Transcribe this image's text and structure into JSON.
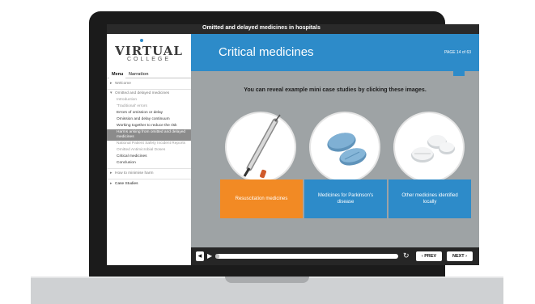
{
  "window": {
    "title": "Omitted and delayed medicines in hospitals"
  },
  "brand": {
    "name": "VIRTUAL",
    "subname": "COLLEGE"
  },
  "sidebar": {
    "tabs": [
      "Menu",
      "Narration"
    ],
    "items": [
      {
        "label": "Welcome",
        "type": "section"
      },
      {
        "label": "Omitted and delayed medicines",
        "type": "section-open"
      },
      {
        "label": "Introduction",
        "type": "dim"
      },
      {
        "label": "'Traditional' errors",
        "type": "dim"
      },
      {
        "label": "Errors of omission or delay",
        "type": "normal"
      },
      {
        "label": "Omission and delay continuum",
        "type": "normal"
      },
      {
        "label": "Working together to reduce the risk",
        "type": "normal"
      },
      {
        "label": "Harms arising from omitted and delayed medicines",
        "type": "highlight"
      },
      {
        "label": "National Patient Safety Incident Reports",
        "type": "dim"
      },
      {
        "label": "Omitted Antimicrobial Doses",
        "type": "dim"
      },
      {
        "label": "Critical medicines",
        "type": "normal"
      },
      {
        "label": "Conclusion",
        "type": "normal"
      },
      {
        "label": "How to minimise harm",
        "type": "section"
      },
      {
        "label": "Case Studies",
        "type": "section-dark"
      }
    ]
  },
  "header": {
    "title": "Critical medicines",
    "page": "PAGE 14 of 63"
  },
  "instruction": "You can reveal example mini case studies by clicking these images.",
  "cards": [
    {
      "label": "Resuscitation medicines",
      "color": "orange",
      "icon": "syringe-icon"
    },
    {
      "label": "Medicines for Parkinson's disease",
      "color": "blue",
      "icon": "tablets-icon"
    },
    {
      "label": "Other medicines identified locally",
      "color": "blue",
      "icon": "pills-icon"
    }
  ],
  "player": {
    "prev": "‹ PREV",
    "next": "NEXT ›",
    "progress": 0.02
  },
  "colors": {
    "accent": "#2d8bc9",
    "orange": "#f28a24"
  }
}
